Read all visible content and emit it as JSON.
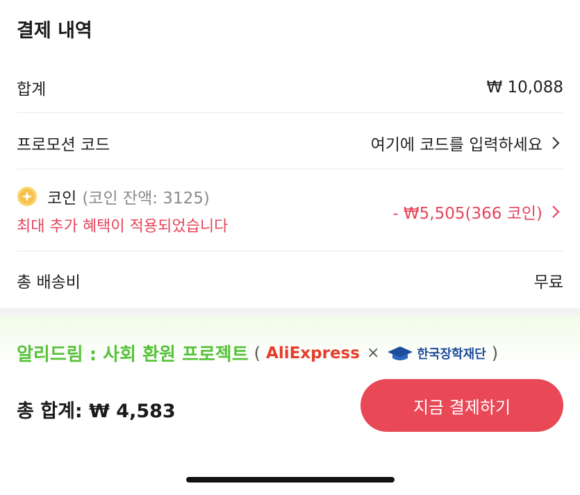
{
  "section": {
    "title": "결제 내역"
  },
  "subtotal": {
    "label": "합계",
    "value": "₩ 10,088"
  },
  "promo": {
    "label": "프로모션 코드",
    "placeholder": "여기에 코드를 입력하세요"
  },
  "coin": {
    "label": "코인",
    "balance": "(코인 잔액: 3125)",
    "note": "최대 추가 혜택이 적용되었습니다",
    "discount": "- ₩5,505(366 코인)"
  },
  "shipping": {
    "label": "총 배송비",
    "value": "무료"
  },
  "banner": {
    "title": "알리드림 : 사회 환원 프로젝트",
    "open_paren": "(",
    "partner1": "AliExpress",
    "times": "×",
    "partner2": "한국장학재단",
    "close_paren": ")"
  },
  "footer": {
    "total": "총 합계: ₩ 4,583",
    "pay_button": "지금 결제하기"
  },
  "colors": {
    "accent": "#e94857",
    "discount_red": "#e5445a",
    "banner_green": "#57c23a"
  }
}
